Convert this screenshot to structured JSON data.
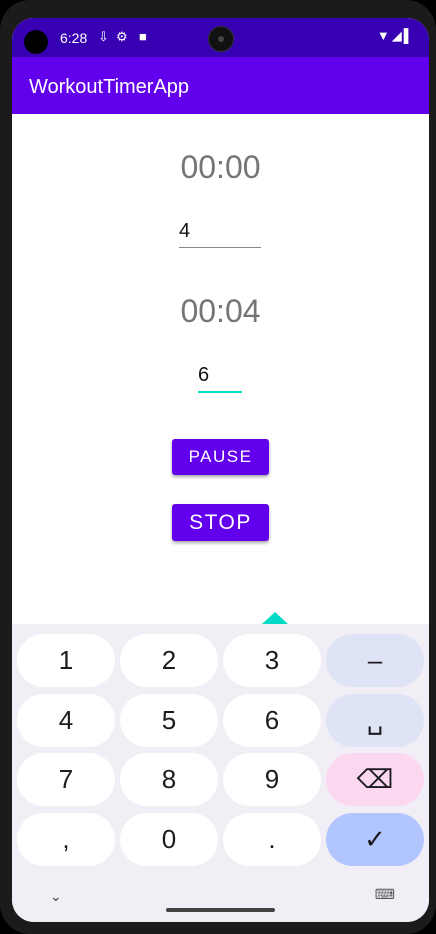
{
  "status_bar": {
    "time": "6:28",
    "icons": [
      "usb-icon",
      "settings-icon",
      "sd-card-icon"
    ],
    "right_icons": [
      "wifi-icon",
      "signal-icon",
      "battery-icon"
    ]
  },
  "app_bar": {
    "title": "WorkoutTimerApp"
  },
  "main": {
    "timer1": "00:00",
    "input1": "4",
    "timer2": "00:04",
    "input2": "6",
    "pause_label": "PAUSE",
    "stop_label": "STOP"
  },
  "keyboard": {
    "rows": [
      [
        "1",
        "2",
        "3",
        "–"
      ],
      [
        "4",
        "5",
        "6",
        "␣"
      ],
      [
        "7",
        "8",
        "9",
        "⌫"
      ],
      [
        ",",
        "0",
        ".",
        "✓"
      ]
    ]
  },
  "colors": {
    "primary": "#6200ee",
    "primary_dark": "#3700b3",
    "accent": "#03dac5"
  }
}
